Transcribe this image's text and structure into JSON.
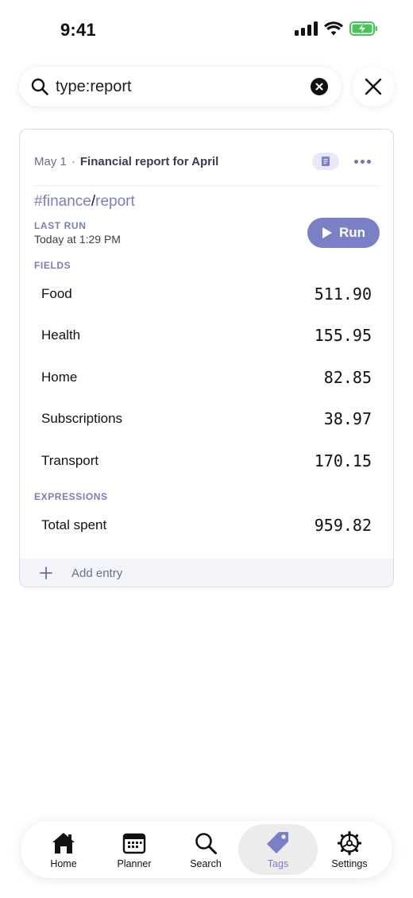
{
  "status_bar": {
    "time": "9:41"
  },
  "search": {
    "query": "type:report",
    "placeholder": ""
  },
  "card": {
    "date": "May 1",
    "separator": "·",
    "title": "Financial report for April",
    "tag_primary": "#finance",
    "tag_separator": "/",
    "tag_secondary": "report",
    "last_run_label": "LAST RUN",
    "last_run_value": "Today at 1:29 PM",
    "run_label": "Run",
    "fields_label": "FIELDS",
    "fields": [
      {
        "name": "Food",
        "value": "511.90"
      },
      {
        "name": "Health",
        "value": "155.95"
      },
      {
        "name": "Home",
        "value": "82.85"
      },
      {
        "name": "Subscriptions",
        "value": "38.97"
      },
      {
        "name": "Transport",
        "value": "170.15"
      }
    ],
    "expressions_label": "EXPRESSIONS",
    "expressions": [
      {
        "name": "Total spent",
        "value": "959.82"
      }
    ],
    "add_entry_label": "Add entry"
  },
  "tab_bar": {
    "active": "Tags",
    "accent_color": "#7b7fc6",
    "tabs": [
      {
        "label": "Home",
        "icon": "home-icon"
      },
      {
        "label": "Planner",
        "icon": "calendar-icon"
      },
      {
        "label": "Search",
        "icon": "search-icon"
      },
      {
        "label": "Tags",
        "icon": "tag-icon"
      },
      {
        "label": "Settings",
        "icon": "gear-icon"
      }
    ]
  }
}
